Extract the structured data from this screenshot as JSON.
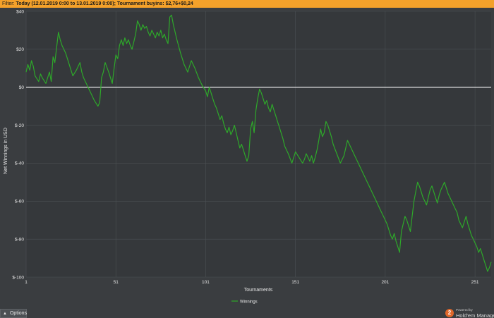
{
  "filter": {
    "label": "Filter:",
    "value": "Today (12.01.2019 0:00 to 13.01.2019 0:00); Tournament buyins: $2,76+$0,24"
  },
  "chart_data": {
    "type": "line",
    "xlabel": "Tournaments",
    "ylabel": "Net Winnings in USD",
    "xlim": [
      1,
      260
    ],
    "ylim": [
      -100,
      40
    ],
    "x_ticks": [
      1,
      51,
      101,
      151,
      201,
      251
    ],
    "x_tick_labels": [
      "1",
      "51",
      "101",
      "151",
      "201",
      "251"
    ],
    "y_ticks": [
      40,
      20,
      0,
      -20,
      -40,
      -60,
      -80,
      -100
    ],
    "y_tick_labels": [
      "$40",
      "$20",
      "$0",
      "$-20",
      "$-40",
      "$-60",
      "$-80",
      "$-100"
    ],
    "grid": true,
    "zero_line": true,
    "legend_position": "bottom-center",
    "series": [
      {
        "name": "Winnings",
        "color": "#2ea82a",
        "x": [
          1,
          2,
          3,
          4,
          5,
          6,
          8,
          9,
          10,
          12,
          13,
          14,
          15,
          16,
          17,
          19,
          20,
          21,
          23,
          25,
          27,
          29,
          31,
          32,
          33,
          35,
          37,
          39,
          41,
          42,
          43,
          44,
          45,
          47,
          49,
          50,
          51,
          52,
          53,
          54,
          55,
          56,
          57,
          58,
          59,
          60,
          61,
          62,
          63,
          64,
          65,
          66,
          67,
          68,
          69,
          70,
          71,
          72,
          73,
          74,
          75,
          76,
          77,
          78,
          79,
          80,
          81,
          82,
          83,
          85,
          87,
          89,
          91,
          93,
          95,
          97,
          99,
          101,
          102,
          103,
          104,
          105,
          106,
          107,
          108,
          109,
          110,
          111,
          112,
          113,
          114,
          115,
          116,
          117,
          118,
          119,
          120,
          121,
          122,
          123,
          124,
          125,
          126,
          127,
          128,
          129,
          130,
          131,
          132,
          133,
          134,
          135,
          136,
          137,
          138,
          139,
          140,
          141,
          142,
          143,
          144,
          145,
          147,
          149,
          151,
          153,
          155,
          156,
          157,
          158,
          159,
          160,
          161,
          162,
          163,
          164,
          165,
          166,
          167,
          168,
          169,
          170,
          171,
          172,
          174,
          176,
          178,
          180,
          182,
          184,
          186,
          188,
          190,
          192,
          194,
          196,
          198,
          200,
          201,
          202,
          203,
          204,
          205,
          206,
          207,
          208,
          209,
          210,
          211,
          212,
          213,
          214,
          215,
          216,
          217,
          218,
          219,
          220,
          221,
          222,
          223,
          224,
          225,
          226,
          227,
          228,
          229,
          230,
          231,
          232,
          233,
          234,
          235,
          236,
          237,
          238,
          239,
          240,
          241,
          242,
          243,
          244,
          245,
          246,
          247,
          248,
          249,
          250,
          251,
          252,
          253,
          254,
          255,
          256,
          257,
          258,
          259,
          260
        ],
        "y": [
          8,
          12,
          9,
          14,
          11,
          6,
          3,
          7,
          5,
          2,
          5,
          8,
          3,
          16,
          13,
          29,
          25,
          22,
          18,
          12,
          6,
          9,
          13,
          8,
          5,
          1,
          -3,
          -7,
          -10,
          -8,
          5,
          8,
          13,
          8,
          2,
          10,
          17,
          15,
          22,
          25,
          22,
          26,
          23,
          25,
          22,
          20,
          24,
          28,
          35,
          33,
          30,
          33,
          31,
          32,
          29,
          27,
          30,
          28,
          26,
          29,
          27,
          30,
          26,
          28,
          25,
          23,
          37,
          38,
          33,
          25,
          18,
          12,
          8,
          14,
          10,
          5,
          1,
          -2,
          -5,
          0,
          -3,
          -6,
          -9,
          -11,
          -14,
          -17,
          -15,
          -19,
          -22,
          -24,
          -21,
          -25,
          -23,
          -20,
          -24,
          -28,
          -32,
          -30,
          -33,
          -36,
          -39,
          -36,
          -22,
          -18,
          -24,
          -12,
          -6,
          -1,
          -3,
          -6,
          -9,
          -7,
          -11,
          -13,
          -9,
          -12,
          -15,
          -18,
          -21,
          -24,
          -27,
          -31,
          -35,
          -40,
          -34,
          -37,
          -40,
          -38,
          -35,
          -37,
          -39,
          -36,
          -40,
          -37,
          -33,
          -28,
          -22,
          -26,
          -24,
          -18,
          -20,
          -23,
          -26,
          -30,
          -35,
          -40,
          -36,
          -28,
          -32,
          -36,
          -40,
          -44,
          -48,
          -52,
          -56,
          -60,
          -64,
          -68,
          -70,
          -72,
          -75,
          -78,
          -80,
          -77,
          -81,
          -84,
          -87,
          -76,
          -72,
          -68,
          -70,
          -73,
          -76,
          -68,
          -60,
          -55,
          -50,
          -52,
          -55,
          -58,
          -60,
          -62,
          -58,
          -54,
          -52,
          -55,
          -58,
          -61,
          -57,
          -54,
          -52,
          -50,
          -53,
          -56,
          -58,
          -60,
          -62,
          -64,
          -66,
          -70,
          -72,
          -74,
          -71,
          -68,
          -72,
          -75,
          -78,
          -80,
          -82,
          -84,
          -87,
          -85,
          -88,
          -91,
          -94,
          -97,
          -95,
          -92
        ]
      }
    ]
  },
  "bottom": {
    "options_label": "Options",
    "brand_powered": "Powered by",
    "brand_name": "Hold'em Manager",
    "brand_logo": "2"
  }
}
